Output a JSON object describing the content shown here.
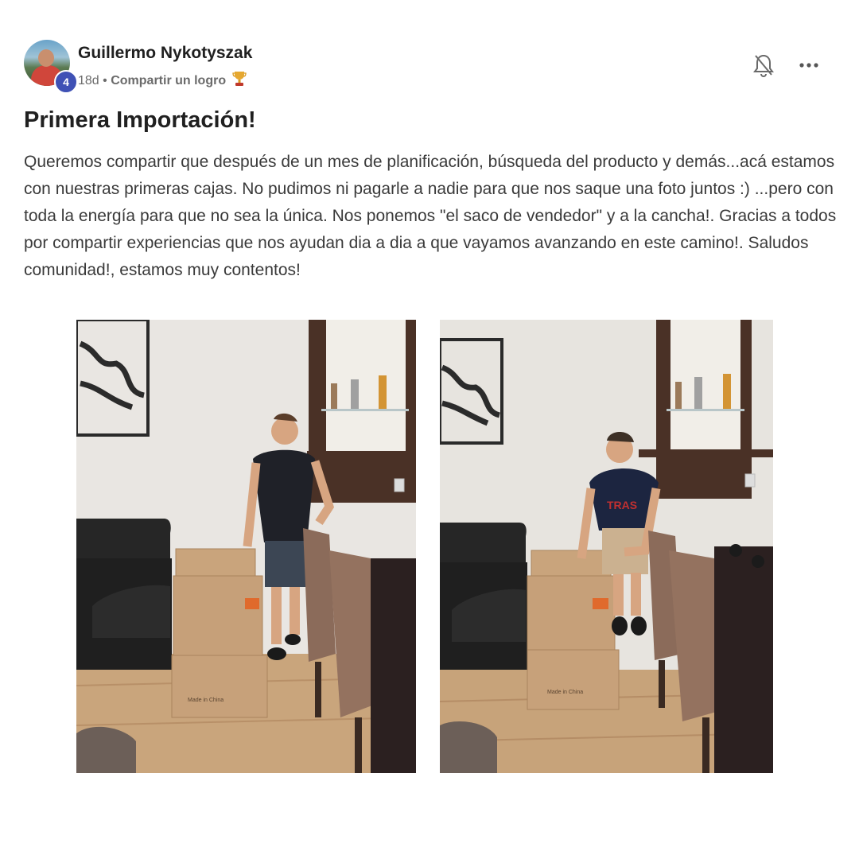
{
  "post": {
    "author": {
      "name": "Guillermo Nykotyszak",
      "level": "4"
    },
    "meta": {
      "time": "18d",
      "separator": "•",
      "category": "Compartir un logro"
    },
    "title": "Primera Importación!",
    "body": "Queremos compartir que después de un mes de planificación, búsqueda del producto y demás...acá estamos con nuestras primeras cajas. No pudimos ni pagarle a nadie para que nos saque una foto juntos :) ...pero con toda la energía para que no sea la única. Nos ponemos \"el saco de vendedor\" y a la cancha!. Gracias a todos por compartir experiencias que nos ayudan dia a dia a que vayamos avanzando en este camino!. Saludos comunidad!, estamos muy contentos!",
    "icons": {
      "trophy": "trophy-icon",
      "notifications": "bell-off-icon",
      "more": "more-options-icon"
    },
    "colors": {
      "level_badge": "#3f51b5",
      "meta_text": "#6b6b6b",
      "body_text": "#3a3a3a"
    },
    "photos": {
      "left": {
        "box_label": "Made in China"
      },
      "right": {
        "box_label": "Made in China"
      }
    }
  }
}
